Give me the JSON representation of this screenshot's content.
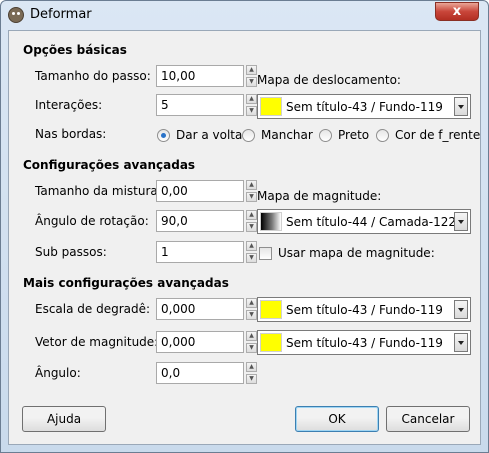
{
  "window": {
    "title": "Deformar",
    "close_label": "x"
  },
  "sections": {
    "basic": "Opções básicas",
    "advanced": "Configurações avançadas",
    "more": "Mais configurações avançadas"
  },
  "basic": {
    "step_label": "Tamanho do passo:",
    "step_value": "10,00",
    "iterations_label": "Interações:",
    "iterations_value": "5",
    "displacement_map_label": "Mapa de deslocamento:",
    "displacement_map_value": "Sem título-43 / Fundo-119",
    "displacement_map_color": "#ffff00",
    "edges_label": "Nas bordas:",
    "edge_options": [
      "Dar a volta",
      "Manchar",
      "Preto",
      "Cor de f_rente"
    ],
    "edge_selected": "Dar a volta"
  },
  "advanced": {
    "dither_label": "Tamanho da mistura:",
    "dither_value": "0,00",
    "rotation_label": "Ângulo de rotação:",
    "rotation_value": "90,0",
    "substeps_label": "Sub passos:",
    "substeps_value": "1",
    "magnitude_map_label": "Mapa de magnitude:",
    "magnitude_map_value": "Sem título-44 / Camada-122",
    "use_magnitude_label": "Usar mapa de magnitude:",
    "use_magnitude_checked": false
  },
  "more": {
    "gradient_scale_label": "Escala de degradê:",
    "gradient_scale_value": "0,000",
    "gradient_map_value": "Sem título-43 / Fundo-119",
    "gradient_map_color": "#ffff00",
    "vector_magnitude_label": "Vetor de magnitude:",
    "vector_magnitude_value": "0,000",
    "vector_map_value": "Sem título-43 / Fundo-119",
    "vector_map_color": "#ffff00",
    "angle_label": "Ângulo:",
    "angle_value": "0,0"
  },
  "buttons": {
    "help": "Ajuda",
    "ok": "OK",
    "cancel": "Cancelar"
  }
}
